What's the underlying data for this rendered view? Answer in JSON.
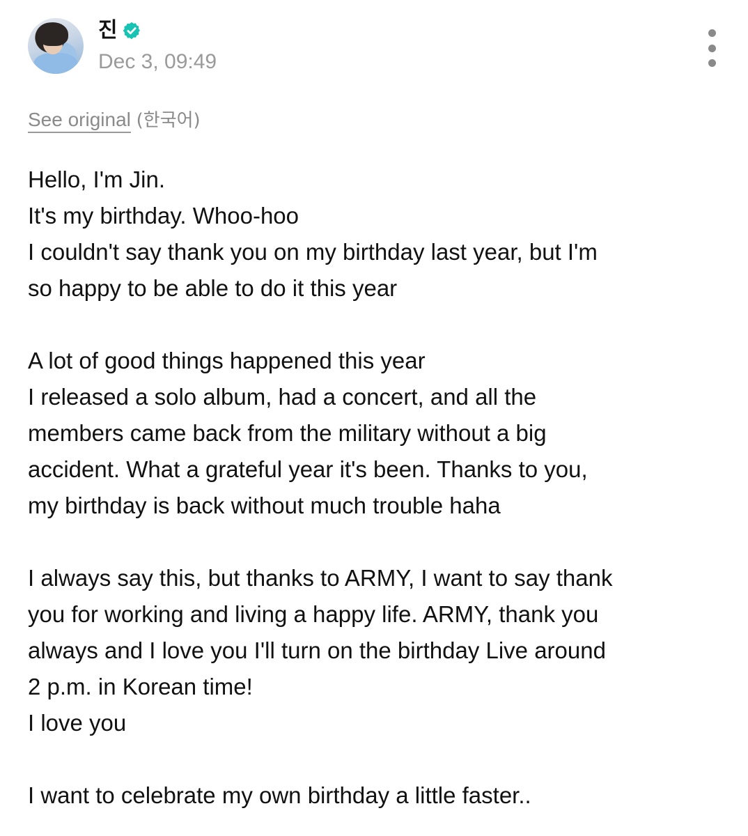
{
  "author": {
    "name": "진",
    "verified": true,
    "time": "Dec 3, 09:49"
  },
  "translation": {
    "see_original": "See original",
    "original_language": "(한국어)"
  },
  "post": {
    "lines": [
      "Hello, I'm Jin.",
      "It's my birthday. Whoo-hoo",
      "I couldn't say thank you on my birthday last year, but I'm",
      "so happy to be able to do it this year",
      "",
      "A lot of good things happened this year",
      "I released a solo album, had a concert, and all the",
      "members came back from the military without a big",
      "accident. What a grateful year it's been. Thanks to you,",
      "my birthday is back without much trouble haha",
      "",
      "I always say this, but thanks to ARMY, I want to say thank",
      "you for working and living a happy life. ARMY, thank you",
      "always and I love you I'll turn on the birthday Live around",
      "2 p.m. in Korean time!",
      "I love you",
      "",
      "I want to celebrate my own birthday a little faster.."
    ]
  },
  "icons": {
    "verified": "verified-badge-icon",
    "more": "more-vertical-icon"
  },
  "colors": {
    "verified_badge": "#17c3b2",
    "secondary_text": "#9a9a9a",
    "body_text": "#111111"
  }
}
